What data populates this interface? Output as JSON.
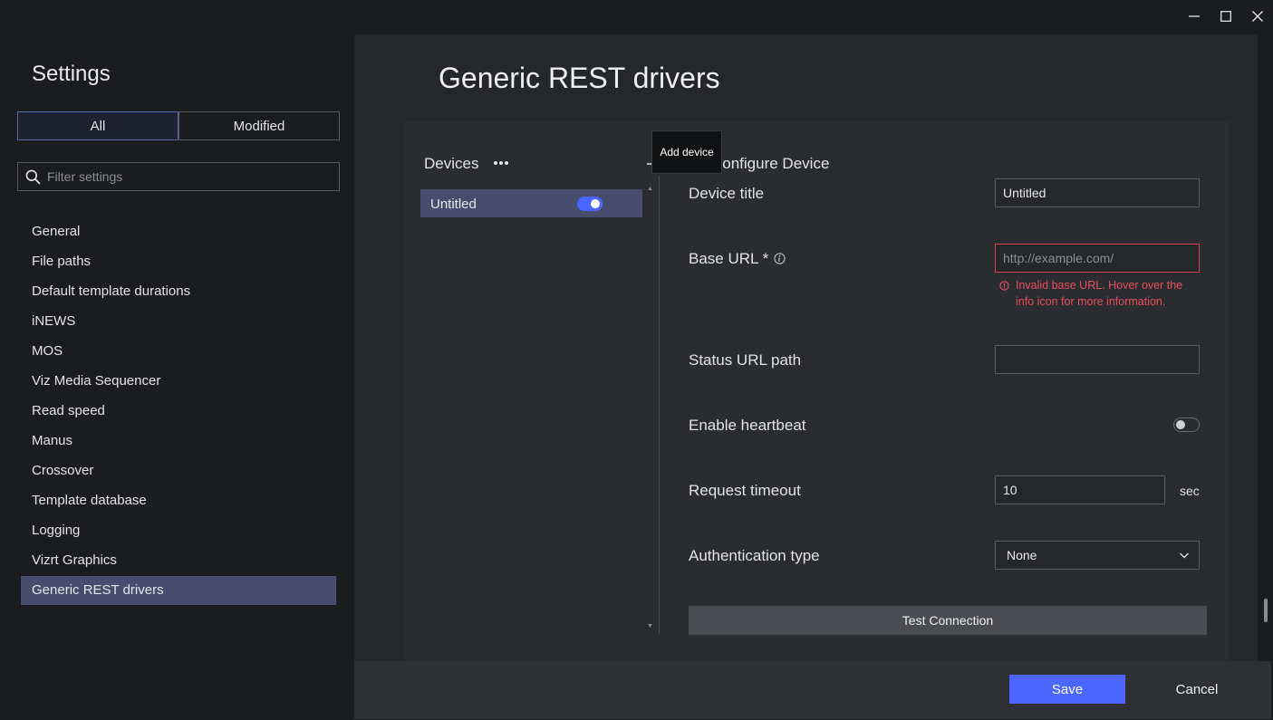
{
  "window": {
    "controls": [
      "minimize-icon",
      "maximize-icon",
      "close-icon"
    ]
  },
  "sidebar": {
    "title": "Settings",
    "tabs": [
      {
        "label": "All",
        "active": true
      },
      {
        "label": "Modified",
        "active": false
      }
    ],
    "filter_placeholder": "Filter settings",
    "items": [
      {
        "label": "General"
      },
      {
        "label": "File paths"
      },
      {
        "label": "Default template durations"
      },
      {
        "label": "iNEWS"
      },
      {
        "label": "MOS"
      },
      {
        "label": "Viz Media Sequencer"
      },
      {
        "label": "Read speed"
      },
      {
        "label": "Manus"
      },
      {
        "label": "Crossover"
      },
      {
        "label": "Template database"
      },
      {
        "label": "Logging"
      },
      {
        "label": "Vizrt Graphics"
      },
      {
        "label": "Generic REST drivers",
        "selected": true
      }
    ]
  },
  "main": {
    "title": "Generic REST drivers",
    "devices": {
      "label": "Devices",
      "add_tooltip": "Add device",
      "list": [
        {
          "name": "Untitled",
          "enabled": true
        }
      ]
    },
    "configure": {
      "title": "Configure Device",
      "device_title_label": "Device title",
      "device_title_value": "Untitled",
      "base_url_label": "Base URL *",
      "base_url_placeholder": "http://example.com/",
      "base_url_error": "Invalid base URL. Hover over the info icon for more information.",
      "status_url_label": "Status URL path",
      "status_url_value": "",
      "heartbeat_label": "Enable heartbeat",
      "heartbeat_enabled": false,
      "timeout_label": "Request timeout",
      "timeout_value": "10",
      "timeout_unit": "sec",
      "auth_label": "Authentication type",
      "auth_value": "None",
      "test_button": "Test Connection"
    }
  },
  "footer": {
    "save_label": "Save",
    "cancel_label": "Cancel"
  },
  "colors": {
    "accent": "#4a66ff",
    "selected_bg": "#474d6e",
    "error": "#e8505c"
  }
}
